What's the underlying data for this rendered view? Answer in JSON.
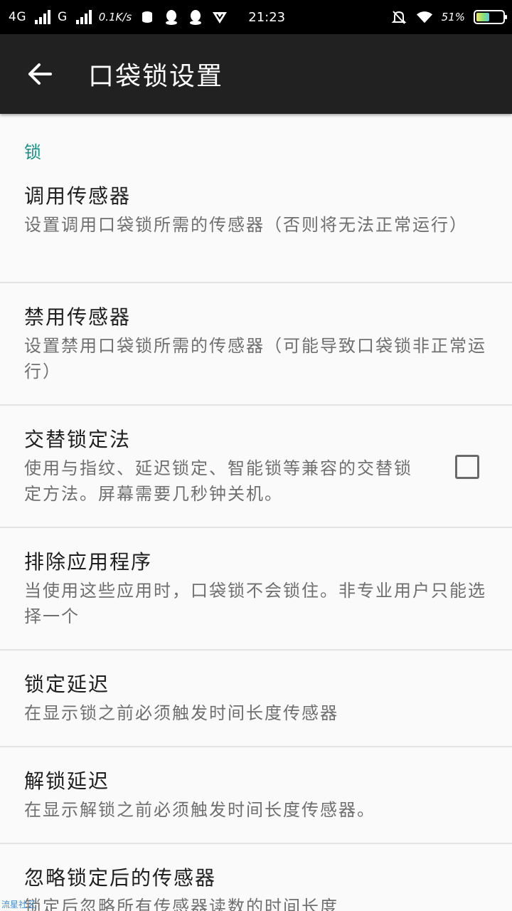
{
  "status_bar": {
    "network1": "4G",
    "network2": "G",
    "speed": "0.1K/s",
    "time": "21:23",
    "battery_text": "51%",
    "battery_level": 0.51
  },
  "app_bar": {
    "title": "口袋锁设置"
  },
  "section": {
    "header": "锁"
  },
  "prefs": [
    {
      "title": "调用传感器",
      "summary": "设置调用口袋锁所需的传感器（否则将无法正常运行）"
    },
    {
      "title": "禁用传感器",
      "summary": "设置禁用口袋锁所需的传感器（可能导致口袋锁非正常运行）"
    },
    {
      "title": "交替锁定法",
      "summary": "使用与指纹、延迟锁定、智能锁等兼容的交替锁定方法。屏幕需要几秒钟关机。",
      "checked": false
    },
    {
      "title": "排除应用程序",
      "summary": "当使用这些应用时，口袋锁不会锁住。非专业用户只能选择一个"
    },
    {
      "title": "锁定延迟",
      "summary": "在显示锁之前必须触发时间长度传感器"
    },
    {
      "title": "解锁延迟",
      "summary": "在显示解锁之前必须触发时间长度传感器。"
    },
    {
      "title": "忽略锁定后的传感器",
      "summary": "锁定后忽略所有传感器读数的时间长度"
    }
  ],
  "watermark": "流星社区"
}
